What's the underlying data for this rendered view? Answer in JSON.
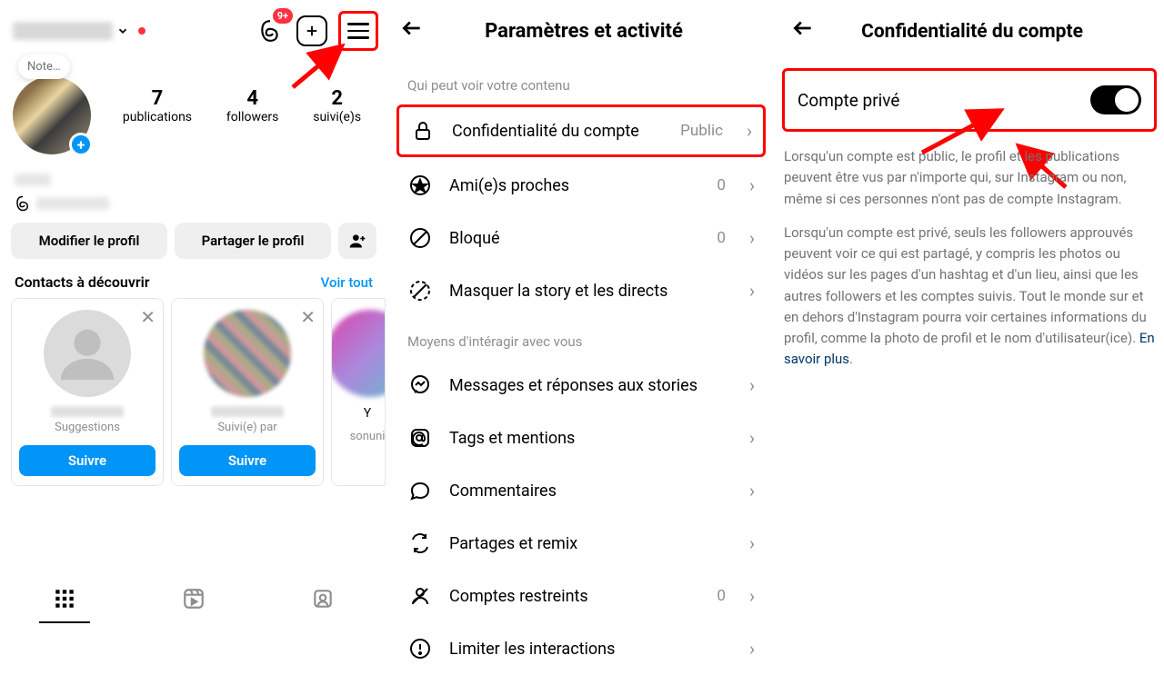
{
  "panel1": {
    "badge": "9+",
    "note_label": "Note…",
    "stats": [
      {
        "num": "7",
        "label": "publications"
      },
      {
        "num": "4",
        "label": "followers"
      },
      {
        "num": "2",
        "label": "suivi(e)s"
      }
    ],
    "edit_profile": "Modifier le profil",
    "share_profile": "Partager le profil",
    "discover_title": "Contacts à découvrir",
    "see_all": "Voir tout",
    "card1_sub": "Suggestions",
    "card2_sub": "Suivi(e) par",
    "card3_name_frag": "Y",
    "card3_sub_frag": "sonuni",
    "follow_btn": "Suivre"
  },
  "panel2": {
    "title": "Paramètres et activité",
    "section1": "Qui peut voir votre contenu",
    "section2": "Moyens d'intéragir avec vous",
    "rows": {
      "privacy": {
        "label": "Confidentialité du compte",
        "value": "Public"
      },
      "close_friends": {
        "label": "Ami(e)s proches",
        "value": "0"
      },
      "blocked": {
        "label": "Bloqué",
        "value": "0"
      },
      "hide_story": {
        "label": "Masquer la story et les directs",
        "value": ""
      },
      "messages": {
        "label": "Messages et réponses aux stories",
        "value": ""
      },
      "tags": {
        "label": "Tags et mentions",
        "value": ""
      },
      "comments": {
        "label": "Commentaires",
        "value": ""
      },
      "sharing": {
        "label": "Partages et remix",
        "value": ""
      },
      "restricted": {
        "label": "Comptes restreints",
        "value": "0"
      },
      "limit": {
        "label": "Limiter les interactions",
        "value": ""
      }
    }
  },
  "panel3": {
    "title": "Confidentialité du compte",
    "toggle_label": "Compte privé",
    "para1": "Lorsqu'un compte est public, le profil et les publications peuvent être vus par n'importe qui, sur Instagram ou non, même si ces personnes n'ont pas de compte Instagram.",
    "para2": "Lorsqu'un compte est privé, seuls les followers approuvés peuvent voir ce qui est partagé, y compris les photos ou vidéos sur les pages d'un hashtag et d'un lieu, ainsi que les autres followers et les comptes suivis. Tout le monde sur et en dehors d'Instagram pourra voir certaines informations du profil, comme la photo de profil et le nom d'utilisateur(ice). ",
    "learn_more": "En savoir plus"
  }
}
